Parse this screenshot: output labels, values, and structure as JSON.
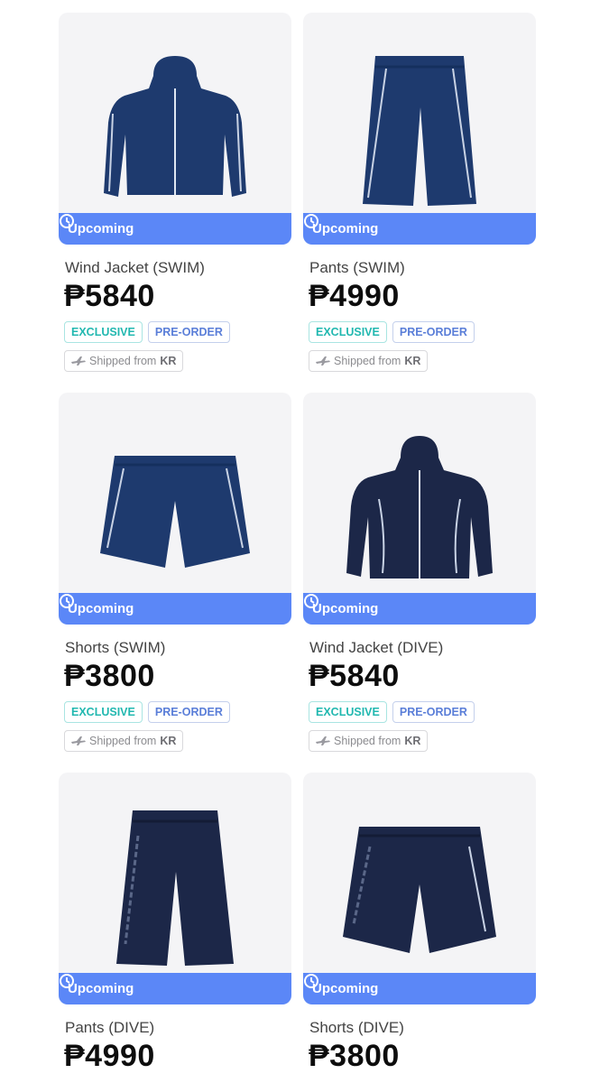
{
  "products": [
    {
      "name": "Wind Jacket (SWIM)",
      "price": "₱5840",
      "status": "Upcoming",
      "badges": [
        "EXCLUSIVE",
        "PRE-ORDER"
      ],
      "shipped_prefix": "Shipped from",
      "shipped_origin": "KR",
      "icon": "jacket-icon",
      "color": "#1e3a6e"
    },
    {
      "name": "Pants (SWIM)",
      "price": "₱4990",
      "status": "Upcoming",
      "badges": [
        "EXCLUSIVE",
        "PRE-ORDER"
      ],
      "shipped_prefix": "Shipped from",
      "shipped_origin": "KR",
      "icon": "pants-icon",
      "color": "#1e3a6e"
    },
    {
      "name": "Shorts (SWIM)",
      "price": "₱3800",
      "status": "Upcoming",
      "badges": [
        "EXCLUSIVE",
        "PRE-ORDER"
      ],
      "shipped_prefix": "Shipped from",
      "shipped_origin": "KR",
      "icon": "shorts-icon",
      "color": "#1e3a6e"
    },
    {
      "name": "Wind Jacket (DIVE)",
      "price": "₱5840",
      "status": "Upcoming",
      "badges": [
        "EXCLUSIVE",
        "PRE-ORDER"
      ],
      "shipped_prefix": "Shipped from",
      "shipped_origin": "KR",
      "icon": "jacket-icon",
      "color": "#1c2748"
    },
    {
      "name": "Pants (DIVE)",
      "price": "₱4990",
      "status": "Upcoming",
      "icon": "pants-icon",
      "color": "#1c2748"
    },
    {
      "name": "Shorts (DIVE)",
      "price": "₱3800",
      "status": "Upcoming",
      "icon": "shorts-icon",
      "color": "#1c2748"
    }
  ],
  "colors": {
    "upcoming_bg": "#5b87f7",
    "exclusive": "#22b8b0",
    "preorder": "#5a7ed8",
    "card_bg": "#f4f4f6"
  }
}
